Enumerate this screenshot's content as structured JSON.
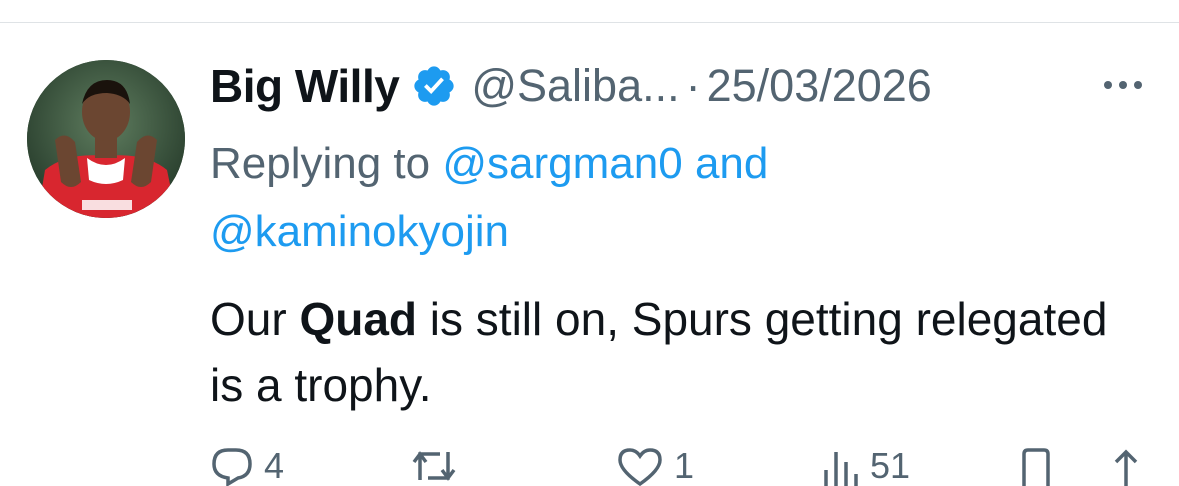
{
  "tweet": {
    "display_name": "Big Willy",
    "handle": "@Saliba...",
    "separator": "·",
    "timestamp": "25/03/2026",
    "replying_prefix": "Replying to",
    "reply_mentions": [
      "@sargman0",
      "@kaminokyojin"
    ],
    "reply_conjunction": "and",
    "text_before": "Our ",
    "text_bold": "Quad",
    "text_after": " is still on, Spurs getting relegated is a trophy."
  },
  "actions": {
    "reply_count": "4",
    "repost_count": "",
    "like_count": "1",
    "views_count": "51"
  },
  "colors": {
    "text": "#0f1419",
    "secondary": "#536471",
    "link": "#1d9bf0",
    "verified": "#1d9bf0"
  },
  "icons": [
    "verified-badge-icon",
    "more-icon",
    "reply-icon",
    "repost-icon",
    "like-icon",
    "views-icon",
    "bookmark-icon",
    "share-icon"
  ]
}
